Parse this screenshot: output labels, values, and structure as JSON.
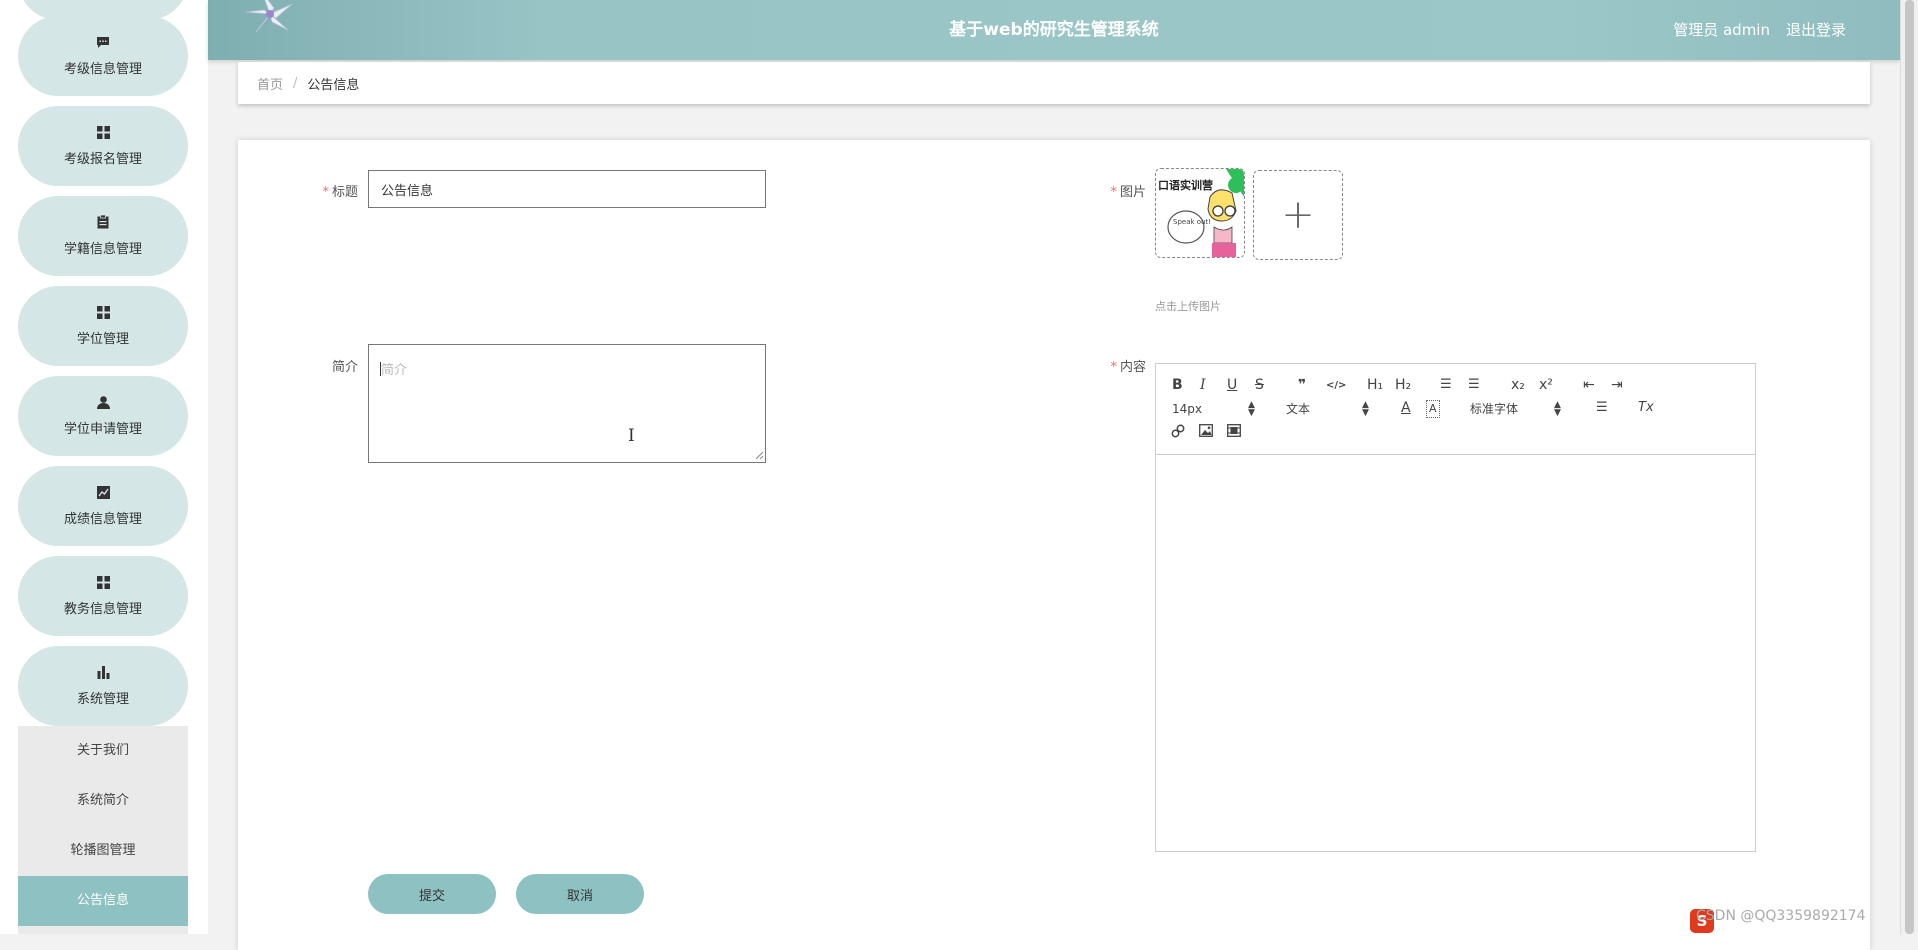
{
  "header": {
    "title": "基于web的研究生管理系统",
    "user": "管理员 admin",
    "logout": "退出登录"
  },
  "sidebar": {
    "items": [
      {
        "label": "考级信息管理",
        "icon": "message-icon",
        "glyph": "▪"
      },
      {
        "label": "考级报名管理",
        "icon": "grid-icon",
        "glyph": "▦"
      },
      {
        "label": "学籍信息管理",
        "icon": "clipboard-icon",
        "glyph": "▤"
      },
      {
        "label": "学位管理",
        "icon": "grid-icon",
        "glyph": "▦"
      },
      {
        "label": "学位申请管理",
        "icon": "user-icon",
        "glyph": "●"
      },
      {
        "label": "成绩信息管理",
        "icon": "line-chart-icon",
        "glyph": "▣"
      },
      {
        "label": "教务信息管理",
        "icon": "grid-icon",
        "glyph": "▦"
      },
      {
        "label": "系统管理",
        "icon": "bar-chart-icon",
        "glyph": "▮"
      }
    ],
    "submenu": [
      "关于我们",
      "系统简介",
      "轮播图管理",
      "公告信息"
    ],
    "active": "公告信息"
  },
  "breadcrumb": {
    "home": "首页",
    "separator": "/",
    "current": "公告信息"
  },
  "form": {
    "title_label": "标题",
    "title_value": "公告信息",
    "intro_label": "简介",
    "intro_placeholder": "简介",
    "image_label": "图片",
    "upload_icon": "+",
    "upload_tip": "点击上传图片",
    "content_label": "内容",
    "thumb_caption": "口语实训营",
    "thumb_bubble": "Speak out!",
    "required_mark": "*"
  },
  "editor": {
    "buttons": {
      "bold": "B",
      "italic": "I",
      "underline": "U",
      "strike": "S",
      "quote": "❞",
      "code": "</>",
      "h1": "H₁",
      "h2": "H₂",
      "ol": "☰",
      "ul": "☰",
      "sub": "x₂",
      "sup": "x²",
      "outdent": "⇤",
      "indent": "⇥",
      "color": "A",
      "background": "A",
      "align": "☰",
      "clean": "Tx",
      "link": "🔗",
      "image": "▨",
      "video": "▣"
    },
    "size": "14px",
    "header": "文本",
    "font": "标准字体"
  },
  "buttons": {
    "submit": "提交",
    "cancel": "取消"
  },
  "watermark": "CSDN @QQ3359892174",
  "colors": {
    "accent": "#8ec1c1",
    "header": "#98c4c6",
    "menu_bg": "#d4e6e6",
    "required": "#f56c6c"
  }
}
